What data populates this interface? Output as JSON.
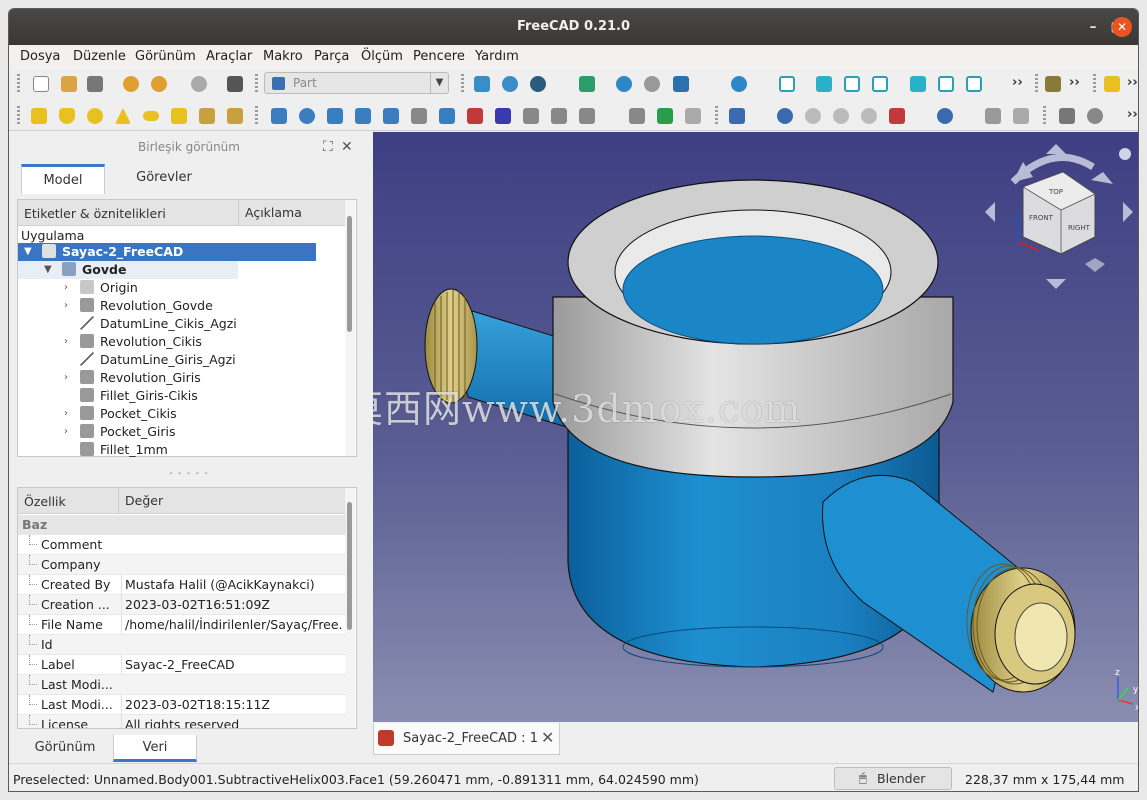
{
  "window": {
    "title": "FreeCAD 0.21.0"
  },
  "menu": [
    "Dosya",
    "Düzenle",
    "Görünüm",
    "Araçlar",
    "Makro",
    "Parça",
    "Ölçüm",
    "Pencere",
    "Yardım"
  ],
  "workbench": {
    "selected": "Part"
  },
  "combo_view": {
    "title": "Birleşik görünüm",
    "tabs": [
      "Model",
      "Görevler"
    ],
    "active_tab": "Model"
  },
  "tree": {
    "columns": [
      "Etiketler & öznitelikleri",
      "Açıklama"
    ],
    "root": "Uygulama",
    "document": "Sayac-2_FreeCAD",
    "body": "Govde",
    "items": [
      "Origin",
      "Revolution_Govde",
      "DatumLine_Cikis_Agzi",
      "Revolution_Cikis",
      "DatumLine_Giris_Agzi",
      "Revolution_Giris",
      "Fillet_Giris-Cikis",
      "Pocket_Cikis",
      "Pocket_Giris",
      "Fillet_1mm"
    ]
  },
  "properties": {
    "columns": [
      "Özellik",
      "Değer"
    ],
    "group": "Baz",
    "rows": [
      {
        "key": "Comment",
        "value": ""
      },
      {
        "key": "Company",
        "value": ""
      },
      {
        "key": "Created By",
        "value": "Mustafa Halil (@AcikKaynakci)"
      },
      {
        "key": "Creation ...",
        "value": "2023-03-02T16:51:09Z"
      },
      {
        "key": "File Name",
        "value": "/home/halil/İndirilenler/Sayaç/Free..."
      },
      {
        "key": "Id",
        "value": ""
      },
      {
        "key": "Label",
        "value": "Sayac-2_FreeCAD"
      },
      {
        "key": "Last Modi...",
        "value": ""
      },
      {
        "key": "Last Modi...",
        "value": "2023-03-02T18:15:11Z"
      },
      {
        "key": "License",
        "value": "All rights reserved"
      }
    ]
  },
  "bottom_tabs": [
    "Görünüm",
    "Veri"
  ],
  "active_bottom_tab": "Veri",
  "document_tab": "Sayac-2_FreeCAD : 1",
  "watermark": "莫西网www.3dmox.com",
  "navcube": {
    "faces": [
      "TOP",
      "RIGHT",
      "FRONT"
    ]
  },
  "status": {
    "preselected": "Preselected: Unnamed.Body001.SubtractiveHelix003.Face1 (59.260471 mm, -0.891311 mm, 64.024590 mm)",
    "navigation": "Blender",
    "dimensions": "228,37 mm x 175,44 mm"
  },
  "colors": {
    "accent": "#3a75c4",
    "model_blue": "#1e88c8",
    "model_gray": "#c8c8c8",
    "thread_gold": "#c8b565",
    "viewport_top": "#3e3f83",
    "viewport_bottom": "#8a8eb0",
    "close_button": "#e95420"
  }
}
